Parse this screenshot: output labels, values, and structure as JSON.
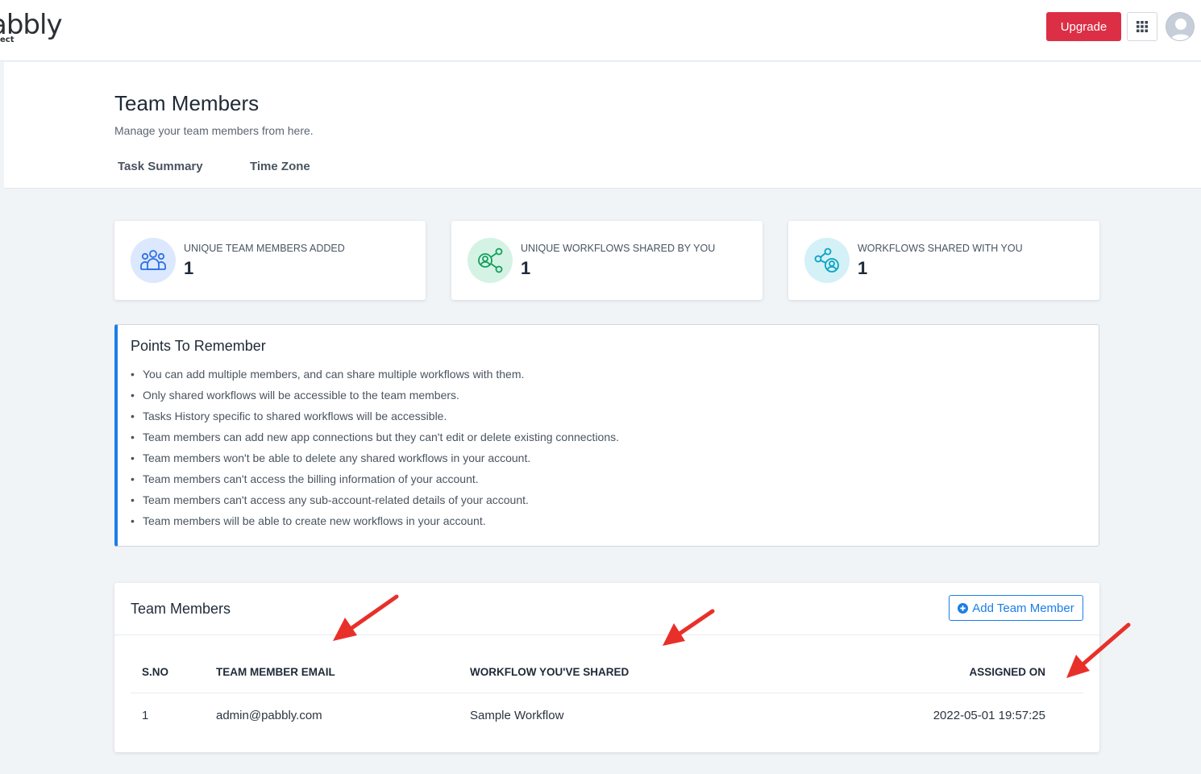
{
  "brand": {
    "logo_text": "abbly",
    "logo_sub": "ect"
  },
  "header": {
    "upgrade_label": "Upgrade",
    "apps_icon": "grid-icon",
    "avatar_icon": "user-avatar-icon"
  },
  "page": {
    "title": "Team Members",
    "subtitle": "Manage your team members from here.",
    "tabs": [
      {
        "label": "Task Summary"
      },
      {
        "label": "Time Zone"
      }
    ]
  },
  "stats": [
    {
      "label": "UNIQUE TEAM MEMBERS ADDED",
      "value": "1",
      "icon": "users-group-icon",
      "icon_color": "#2f6fe4",
      "icon_bg": "#dbe8fd"
    },
    {
      "label": "UNIQUE WORKFLOWS SHARED BY YOU",
      "value": "1",
      "icon": "share-user-icon",
      "icon_color": "#12a05c",
      "icon_bg": "#d5f3e4"
    },
    {
      "label": "WORKFLOWS SHARED WITH YOU",
      "value": "1",
      "icon": "shared-with-user-icon",
      "icon_color": "#0aa3c2",
      "icon_bg": "#d3f1f7"
    }
  ],
  "points": {
    "title": "Points To Remember",
    "items": [
      "You can add multiple members, and can share multiple workflows with them.",
      "Only shared workflows will be accessible to the team members.",
      "Tasks History specific to shared workflows will be accessible.",
      "Team members can add new app connections but they can't edit or delete existing connections.",
      "Team members won't be able to delete any shared workflows in your account.",
      "Team members can't access the billing information of your account.",
      "Team members can't access any sub-account-related details of your account.",
      "Team members will be able to create new workflows in your account."
    ]
  },
  "team": {
    "title": "Team Members",
    "add_label": "Add Team Member",
    "columns": [
      "S.NO",
      "TEAM MEMBER EMAIL",
      "WORKFLOW YOU'VE SHARED",
      "ASSIGNED ON"
    ],
    "rows": [
      {
        "sno": "1",
        "email": "admin@pabbly.com",
        "workflow": "Sample Workflow",
        "assigned_on": "2022-05-01 19:57:25"
      }
    ]
  },
  "colors": {
    "accent": "#1c7ee6",
    "upgrade": "#dc2f45",
    "annotation": "#e8302a"
  }
}
